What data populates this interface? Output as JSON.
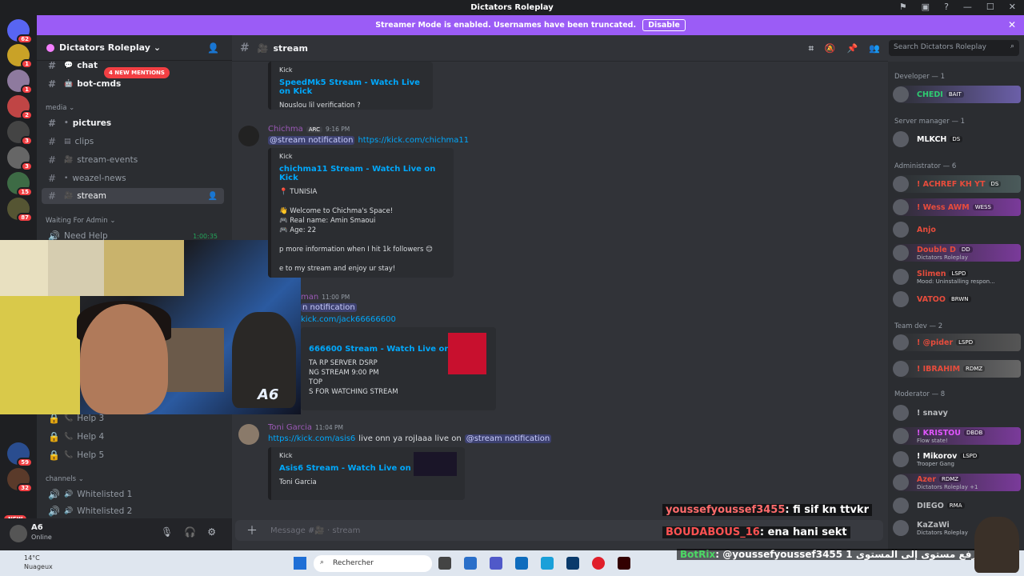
{
  "window": {
    "title": "Dictators Roleplay"
  },
  "banner": {
    "text": "Streamer Mode is enabled. Usernames have been truncated.",
    "button": "Disable"
  },
  "guilds": {
    "badges": [
      "62",
      "1",
      "1",
      "2",
      "3",
      "3",
      "15",
      "87",
      "59",
      "32"
    ],
    "new_label": "NEW"
  },
  "sidebar": {
    "server_name": "Dictators Roleplay",
    "mentions_pill": "4 NEW MENTIONS",
    "channels_top": [
      {
        "name": "chat"
      },
      {
        "name": "bot-cmds"
      }
    ],
    "category_media": "media",
    "media_channels": [
      {
        "name": "pictures"
      },
      {
        "name": "clips"
      },
      {
        "name": "stream-events"
      },
      {
        "name": "weazel-news"
      },
      {
        "name": "stream"
      }
    ],
    "category_waiting": "Waiting For Admin",
    "need_help": "Need Help",
    "need_help_time": "1:00:35",
    "voice_help": [
      "Help 3",
      "Help 4",
      "Help 5"
    ],
    "category_channels": "channels",
    "whitelisted": [
      "Whitelisted 1",
      "Whitelisted 2"
    ]
  },
  "user": {
    "name": "A6",
    "status": "Online"
  },
  "header": {
    "channel": "stream",
    "search_placeholder": "Search Dictators Roleplay"
  },
  "messages": [
    {
      "embed_provider": "Kick",
      "embed_title": "SpeedMk5 Stream - Watch Live on Kick",
      "embed_desc": "Nouslou lil verification ?"
    },
    {
      "author": "Chichma",
      "tag": "ARC",
      "time": "9:16 PM",
      "mention": "@stream notification",
      "link": "https://kick.com/chichma11",
      "embed_provider": "Kick",
      "embed_title": "chichma11 Stream - Watch Live on Kick",
      "embed_desc": "📍 TUNISIA\n\n👋 Welcome to Chichma's Space!\n🎮 Real name: Amin Smaoui\n🎮 Age: 22\n\np more information when I hit 1k followers 😊\n\ne to my stream and enjoy ur stay!"
    },
    {
      "author": "man",
      "time": "11:00 PM",
      "mention": "n notification",
      "link": "kick.com/jack66666600",
      "embed_title": "666600 Stream - Watch Live on Kick",
      "embed_desc": "TA RP SERVER DSRP\nNG STREAM 9:00 PM\nTOP\nS FOR WATCHING STREAM"
    },
    {
      "author": "Toni Garcia",
      "time": "11:04 PM",
      "link": "https://kick.com/asis6",
      "text": "live onn ya rojlaaa live  on",
      "mention": "@stream notification",
      "embed_provider": "Kick",
      "embed_title": "Asis6 Stream - Watch Live on Kick",
      "embed_desc": "Toni Garcia"
    }
  ],
  "composer": {
    "placeholder": "Message #🎥 · stream"
  },
  "members": {
    "categories": [
      "Developer — 1",
      "Server manager — 1",
      "Administrator — 6",
      "Team dev — 2",
      "Moderator — 8"
    ],
    "list": [
      {
        "name": "CHEDI",
        "tag": "BAIT",
        "color": "#2ecc71"
      },
      {
        "name": "MLKCH",
        "tag": "DS",
        "color": "#ffffff"
      },
      {
        "name": "! ACHREF KH YT",
        "tag": "DS",
        "color": "#e74c3c"
      },
      {
        "name": "! Wess AWM",
        "tag": "WESS",
        "color": "#e74c3c"
      },
      {
        "name": "Anjo",
        "tag": "",
        "color": "#e74c3c"
      },
      {
        "name": "Double D",
        "tag": "DD",
        "color": "#e74c3c",
        "status": "Dictators Roleplay"
      },
      {
        "name": "Slimen",
        "tag": "LSPD",
        "color": "#e74c3c",
        "status": "Mood: Uninstalling respon..."
      },
      {
        "name": "VATOO",
        "tag": "BRWN",
        "color": "#e74c3c"
      },
      {
        "name": "! @pider",
        "tag": "LSPD",
        "color": "#e74c3c"
      },
      {
        "name": "! IBRAHIM",
        "tag": "RDMZ",
        "color": "#e74c3c"
      },
      {
        "name": "! snavy",
        "tag": "",
        "color": "#b9bbbe"
      },
      {
        "name": "! KRISTOU",
        "tag": "DBDB",
        "color": "#e056fd",
        "status": "Flow state!"
      },
      {
        "name": "! Mikorov",
        "tag": "LSPD",
        "color": "#ffffff",
        "status": "Trooper Gang"
      },
      {
        "name": "Azer",
        "tag": "RDMZ",
        "color": "#e74c3c",
        "status": "Dictators Roleplay +1"
      },
      {
        "name": "DIEGO",
        "tag": "RMA",
        "color": "#b9bbbe"
      },
      {
        "name": "KaZaWi",
        "tag": "",
        "color": "#b9bbbe",
        "status": "Dictators Roleplay"
      }
    ]
  },
  "stream_overlay": [
    {
      "user": "youssefyoussef3455",
      "text": ": fi sif kn ttvkr"
    },
    {
      "user": "BOUDABOUS_16",
      "text": ": ena hani sekt"
    },
    {
      "user": "BotRix",
      "text": ": @youssefyoussef3455 1 يرفع مستوى إلى المستوى"
    }
  ],
  "taskbar": {
    "temp": "14°C",
    "weather": "Nuageux",
    "search": "Rechercher"
  },
  "colors": {
    "banner": "#9b5cf6",
    "mention_red": "#f23f43",
    "link": "#00a8fc"
  }
}
